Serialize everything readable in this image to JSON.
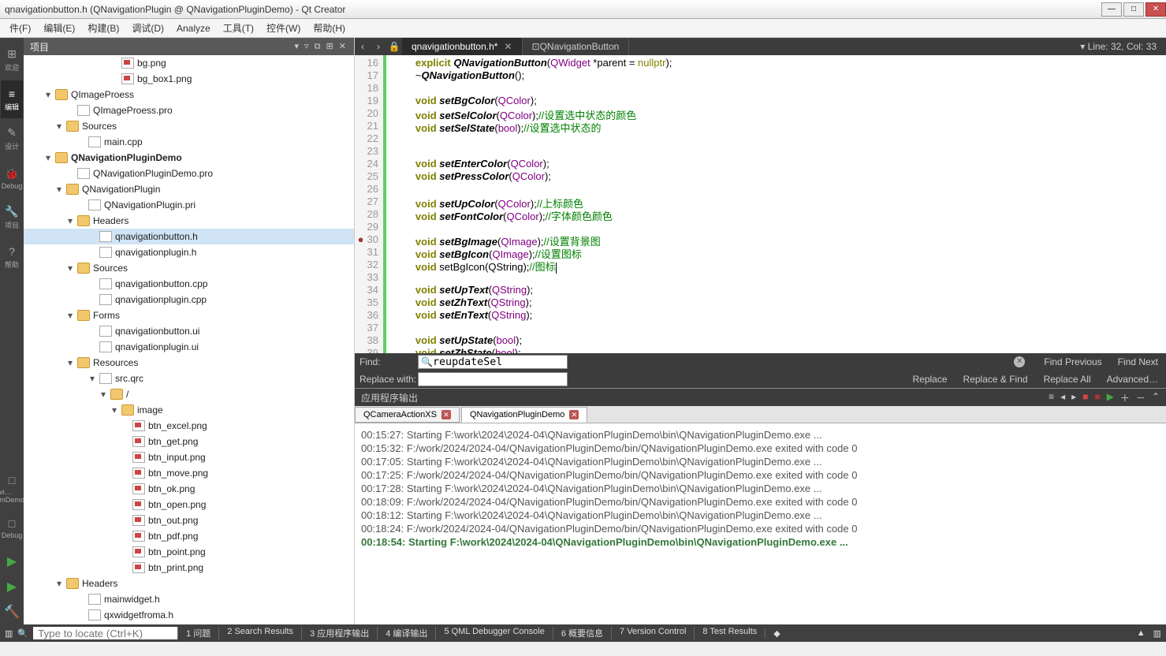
{
  "window": {
    "title": "qnavigationbutton.h (QNavigationPlugin @ QNavigationPluginDemo) - Qt Creator"
  },
  "menu": [
    "件(F)",
    "编辑(E)",
    "构建(B)",
    "调试(D)",
    "Analyze",
    "工具(T)",
    "控件(W)",
    "帮助(H)"
  ],
  "leftbar": [
    {
      "label": "欢迎",
      "icon": "⊞"
    },
    {
      "label": "编辑",
      "icon": "≡"
    },
    {
      "label": "设计",
      "icon": "✎"
    },
    {
      "label": "Debug",
      "icon": "🐞"
    },
    {
      "label": "项目",
      "icon": "🔧"
    },
    {
      "label": "帮助",
      "icon": "?"
    }
  ],
  "leftbottom": [
    {
      "label": "vi…mDemo",
      "icon": "□"
    },
    {
      "label": "Debug",
      "icon": "□"
    }
  ],
  "sidepanel": {
    "title": "项目",
    "tree": [
      {
        "d": 8,
        "t": "img",
        "l": "bg.png"
      },
      {
        "d": 8,
        "t": "img",
        "l": "bg_box1.png"
      },
      {
        "d": 2,
        "t": "folder",
        "l": "QImageProess",
        "exp": true,
        "arrow": "▾"
      },
      {
        "d": 4,
        "t": "pro",
        "l": "QImageProess.pro"
      },
      {
        "d": 3,
        "t": "folder",
        "l": "Sources",
        "exp": true,
        "arrow": "▾"
      },
      {
        "d": 5,
        "t": "cpp",
        "l": "main.cpp"
      },
      {
        "d": 2,
        "t": "folder",
        "l": "QNavigationPluginDemo",
        "exp": true,
        "arrow": "▾",
        "bold": true
      },
      {
        "d": 4,
        "t": "pro",
        "l": "QNavigationPluginDemo.pro"
      },
      {
        "d": 3,
        "t": "folder",
        "l": "QNavigationPlugin",
        "exp": true,
        "arrow": "▾"
      },
      {
        "d": 5,
        "t": "pro",
        "l": "QNavigationPlugin.pri"
      },
      {
        "d": 4,
        "t": "folder",
        "l": "Headers",
        "exp": true,
        "arrow": "▾"
      },
      {
        "d": 6,
        "t": "cpp",
        "l": "qnavigationbutton.h",
        "sel": true
      },
      {
        "d": 6,
        "t": "cpp",
        "l": "qnavigationplugin.h"
      },
      {
        "d": 4,
        "t": "folder",
        "l": "Sources",
        "exp": true,
        "arrow": "▾"
      },
      {
        "d": 6,
        "t": "cpp",
        "l": "qnavigationbutton.cpp"
      },
      {
        "d": 6,
        "t": "cpp",
        "l": "qnavigationplugin.cpp"
      },
      {
        "d": 4,
        "t": "folder",
        "l": "Forms",
        "exp": true,
        "arrow": "▾"
      },
      {
        "d": 6,
        "t": "ui",
        "l": "qnavigationbutton.ui"
      },
      {
        "d": 6,
        "t": "ui",
        "l": "qnavigationplugin.ui"
      },
      {
        "d": 4,
        "t": "folder",
        "l": "Resources",
        "exp": true,
        "arrow": "▾"
      },
      {
        "d": 6,
        "t": "pro",
        "l": "src.qrc",
        "arrow": "▾"
      },
      {
        "d": 7,
        "t": "folder",
        "l": "/",
        "arrow": "▾"
      },
      {
        "d": 8,
        "t": "folder",
        "l": "image",
        "arrow": "▾"
      },
      {
        "d": 9,
        "t": "img",
        "l": "btn_excel.png"
      },
      {
        "d": 9,
        "t": "img",
        "l": "btn_get.png"
      },
      {
        "d": 9,
        "t": "img",
        "l": "btn_input.png"
      },
      {
        "d": 9,
        "t": "img",
        "l": "btn_move.png"
      },
      {
        "d": 9,
        "t": "img",
        "l": "btn_ok.png"
      },
      {
        "d": 9,
        "t": "img",
        "l": "btn_open.png"
      },
      {
        "d": 9,
        "t": "img",
        "l": "btn_out.png"
      },
      {
        "d": 9,
        "t": "img",
        "l": "btn_pdf.png"
      },
      {
        "d": 9,
        "t": "img",
        "l": "btn_point.png"
      },
      {
        "d": 9,
        "t": "img",
        "l": "btn_print.png"
      },
      {
        "d": 3,
        "t": "folder",
        "l": "Headers",
        "exp": true,
        "arrow": "▾"
      },
      {
        "d": 5,
        "t": "cpp",
        "l": "mainwidget.h"
      },
      {
        "d": 5,
        "t": "cpp",
        "l": "qxwidgetfroma.h"
      }
    ]
  },
  "tabs": {
    "back": "‹",
    "fwd": "›",
    "items": [
      {
        "label": "qnavigationbutton.h*",
        "active": true,
        "close": true
      },
      {
        "label": "QNavigationButton",
        "icon": "⊡"
      }
    ],
    "pos": "Line: 32, Col: 33"
  },
  "code": {
    "start": 16,
    "lines": [
      {
        "n": 16,
        "h": "        <kw>explicit</kw> <fn>QNavigationButton</fn>(<typ>QWidget</typ> *parent = <lit>nullptr</lit>);"
      },
      {
        "n": 17,
        "h": "        ~<fn>QNavigationButton</fn>();"
      },
      {
        "n": 18,
        "h": ""
      },
      {
        "n": 19,
        "h": "        <kw>void</kw> <fn>setBgColor</fn>(<typ>QColor</typ>);"
      },
      {
        "n": 20,
        "h": "        <kw>void</kw> <fn>setSelColor</fn>(<typ>QColor</typ>);<com>//设置选中状态的颜色</com>"
      },
      {
        "n": 21,
        "h": "        <kw>void</kw> <fn>setSelState</fn>(<typ>bool</typ>);<com>//设置选中状态的</com>"
      },
      {
        "n": 22,
        "h": ""
      },
      {
        "n": 23,
        "h": ""
      },
      {
        "n": 24,
        "h": "        <kw>void</kw> <fn>setEnterColor</fn>(<typ>QColor</typ>);"
      },
      {
        "n": 25,
        "h": "        <kw>void</kw> <fn>setPressColor</fn>(<typ>QColor</typ>);"
      },
      {
        "n": 26,
        "h": ""
      },
      {
        "n": 27,
        "h": "        <kw>void</kw> <fn>setUpColor</fn>(<typ>QColor</typ>);<com>//上标颜色</com>"
      },
      {
        "n": 28,
        "h": "        <kw>void</kw> <fn>setFontColor</fn>(<typ>QColor</typ>);<com>//字体颜色颜色</com>"
      },
      {
        "n": 29,
        "h": ""
      },
      {
        "n": 30,
        "bp": true,
        "h": "        <kw>void</kw> <fn>setBgImage</fn>(<typ>QImage</typ>);<com>//设置背景图</com>"
      },
      {
        "n": 31,
        "h": "        <kw>void</kw> <fn>setBgIcon</fn>(<typ>QImage</typ>);<com>//设置图标</com>"
      },
      {
        "n": 32,
        "h": "        <kw>void</kw> setBgIcon(QString);<com>//图标</com><cursor></cursor>"
      },
      {
        "n": 33,
        "h": ""
      },
      {
        "n": 34,
        "h": "        <kw>void</kw> <fn>setUpText</fn>(<typ>QString</typ>);"
      },
      {
        "n": 35,
        "h": "        <kw>void</kw> <fn>setZhText</fn>(<typ>QString</typ>);"
      },
      {
        "n": 36,
        "h": "        <kw>void</kw> <fn>setEnText</fn>(<typ>QString</typ>);"
      },
      {
        "n": 37,
        "h": ""
      },
      {
        "n": 38,
        "h": "        <kw>void</kw> <fn>setUpState</fn>(<typ>bool</typ>);"
      },
      {
        "n": 39,
        "h": "        <kw>void</kw> <fn>setZhState</fn>(<typ>bool</typ>);"
      }
    ]
  },
  "find": {
    "label": "Find:",
    "value": "reupdateSel",
    "replaceLabel": "Replace with:",
    "btns": [
      "Find Previous",
      "Find Next"
    ],
    "rbtns": [
      "Replace",
      "Replace & Find",
      "Replace All",
      "Advanced…"
    ]
  },
  "output": {
    "header": "应用程序输出",
    "tabs": [
      {
        "label": "QCameraActionXS",
        "close": true
      },
      {
        "label": "QNavigationPluginDemo",
        "close": true,
        "active": true
      }
    ],
    "lines": [
      {
        "t": "00:15:27: Starting F:\\work\\2024\\2024-04\\QNavigationPluginDemo\\bin\\QNavigationPluginDemo.exe ..."
      },
      {
        "t": "00:15:32: F:/work/2024/2024-04/QNavigationPluginDemo/bin/QNavigationPluginDemo.exe exited with code 0"
      },
      {
        "t": ""
      },
      {
        "t": "00:17:05: Starting F:\\work\\2024\\2024-04\\QNavigationPluginDemo\\bin\\QNavigationPluginDemo.exe ..."
      },
      {
        "t": "00:17:25: F:/work/2024/2024-04/QNavigationPluginDemo/bin/QNavigationPluginDemo.exe exited with code 0"
      },
      {
        "t": ""
      },
      {
        "t": "00:17:28: Starting F:\\work\\2024\\2024-04\\QNavigationPluginDemo\\bin\\QNavigationPluginDemo.exe ..."
      },
      {
        "t": "00:18:09: F:/work/2024/2024-04/QNavigationPluginDemo/bin/QNavigationPluginDemo.exe exited with code 0"
      },
      {
        "t": ""
      },
      {
        "t": "00:18:12: Starting F:\\work\\2024\\2024-04\\QNavigationPluginDemo\\bin\\QNavigationPluginDemo.exe ..."
      },
      {
        "t": "00:18:24: F:/work/2024/2024-04/QNavigationPluginDemo/bin/QNavigationPluginDemo.exe exited with code 0"
      },
      {
        "t": ""
      },
      {
        "t": "00:18:54: Starting F:\\work\\2024\\2024-04\\QNavigationPluginDemo\\bin\\QNavigationPluginDemo.exe ...",
        "g": true
      }
    ]
  },
  "status": {
    "locatorPh": "Type to locate (Ctrl+K)",
    "items": [
      "1  问题",
      "2  Search Results",
      "3  应用程序输出",
      "4  编译输出",
      "5  QML Debugger Console",
      "6  概要信息",
      "7  Version Control",
      "8  Test Results"
    ]
  }
}
